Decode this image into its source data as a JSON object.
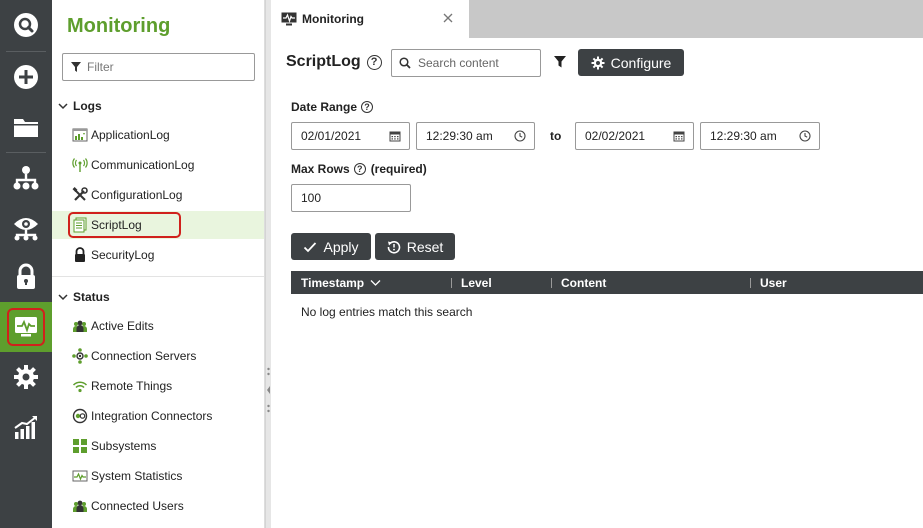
{
  "nav": {
    "title": "Monitoring",
    "filter_placeholder": "Filter",
    "sections": [
      {
        "label": "Logs",
        "items": [
          {
            "label": "ApplicationLog",
            "icon": "application-log-icon"
          },
          {
            "label": "CommunicationLog",
            "icon": "communication-log-icon"
          },
          {
            "label": "ConfigurationLog",
            "icon": "configuration-log-icon"
          },
          {
            "label": "ScriptLog",
            "icon": "script-log-icon",
            "selected": true
          },
          {
            "label": "SecurityLog",
            "icon": "lock-icon"
          }
        ]
      },
      {
        "label": "Status",
        "items": [
          {
            "label": "Active Edits",
            "icon": "active-edits-icon"
          },
          {
            "label": "Connection Servers",
            "icon": "connection-servers-icon"
          },
          {
            "label": "Remote Things",
            "icon": "remote-things-icon"
          },
          {
            "label": "Integration Connectors",
            "icon": "integration-connectors-icon"
          },
          {
            "label": "Subsystems",
            "icon": "subsystems-icon"
          },
          {
            "label": "System Statistics",
            "icon": "system-statistics-icon"
          },
          {
            "label": "Connected Users",
            "icon": "connected-users-icon"
          }
        ]
      }
    ]
  },
  "rail": [
    "search-icon",
    "add-icon",
    "folder-icon",
    "hierarchy-icon",
    "eye-icon",
    "lock-icon",
    "monitoring-icon",
    "gear-icon",
    "analytics-icon"
  ],
  "tab": {
    "label": "Monitoring"
  },
  "main": {
    "title": "ScriptLog",
    "search_placeholder": "Search content",
    "configure_label": "Configure",
    "date_range_label": "Date Range",
    "from_date": "02/01/2021",
    "from_time": "12:29:30 am",
    "to_label": "to",
    "to_date": "02/02/2021",
    "to_time": "12:29:30 am",
    "max_rows_label": "Max Rows",
    "max_rows_required": "(required)",
    "max_rows_value": "100",
    "apply_label": "Apply",
    "reset_label": "Reset",
    "columns": [
      "Timestamp",
      "Level",
      "Content",
      "User"
    ],
    "empty_message": "No log entries match this search"
  },
  "colors": {
    "accent": "#5e9e2d",
    "dark": "#3d4144",
    "highlight": "#d0211c",
    "selected_bg": "#e9f5de"
  }
}
